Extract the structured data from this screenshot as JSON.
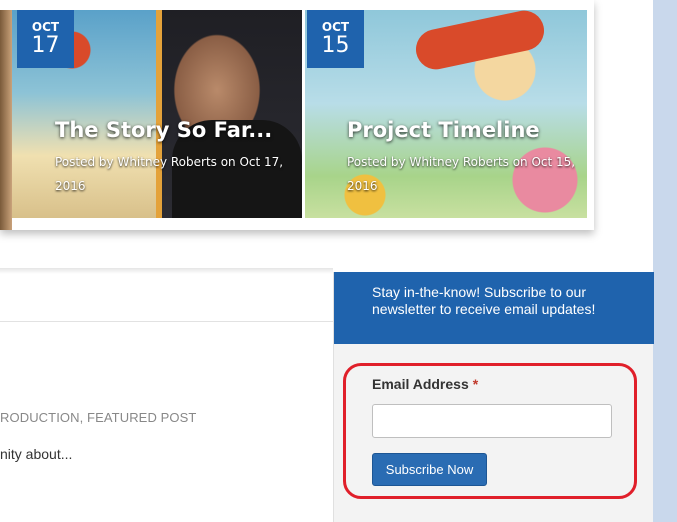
{
  "featured_posts": [
    {
      "month": "OCT",
      "day": "17",
      "title": "The Story So Far...",
      "meta_line1": "Posted by Whitney Roberts on Oct 17,",
      "meta_line2": "2016"
    },
    {
      "month": "OCT",
      "day": "15",
      "title": "Project Timeline",
      "meta_line1": "Posted by Whitney Roberts on Oct 15,",
      "meta_line2": "2016"
    }
  ],
  "post": {
    "categories": "RODUCTION, FEATURED POST",
    "excerpt": "nity about..."
  },
  "subscribe_widget": {
    "heading": "Stay in-the-know! Subscribe to our newsletter to receive email updates!",
    "email_label": "Email Address",
    "required_marker": "*",
    "email_value": "",
    "button_label": "Subscribe Now"
  },
  "colors": {
    "brand_blue": "#1f63ad",
    "highlight_red": "#e01f2a"
  }
}
